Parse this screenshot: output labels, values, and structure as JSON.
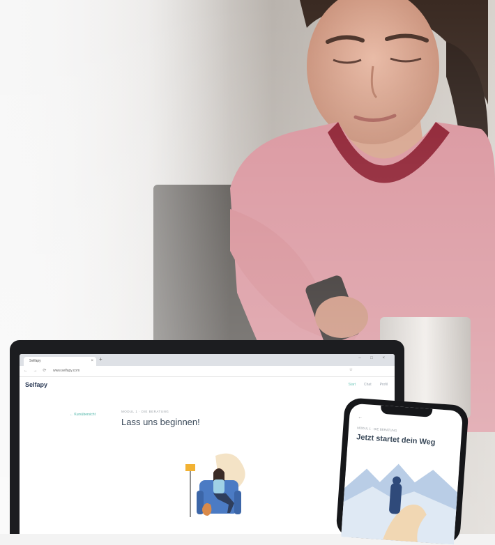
{
  "browser": {
    "tab_title": "Selfapy",
    "tab_close": "×",
    "new_tab": "+",
    "window_controls": "– □ ×",
    "nav_icons": "← → ⟳",
    "url": "www.selfapy.com",
    "star": "☆"
  },
  "app": {
    "logo": "Selfapy",
    "header_items": [
      "Start",
      "Chat",
      "Profil"
    ],
    "back_link": "← Kursübersicht",
    "breadcrumb": "MODUL 1 · DIE BERATUNG",
    "title": "Lass uns beginnen!"
  },
  "phone": {
    "back": "←",
    "breadcrumb": "MODUL 1 · DIE BERATUNG",
    "title": "Jetzt startet dein Weg"
  },
  "colors": {
    "accent": "#6cc6b9",
    "shirt": "#d9939c",
    "collar": "#8b1a2c",
    "laptop_bezel": "#1c1d20"
  }
}
